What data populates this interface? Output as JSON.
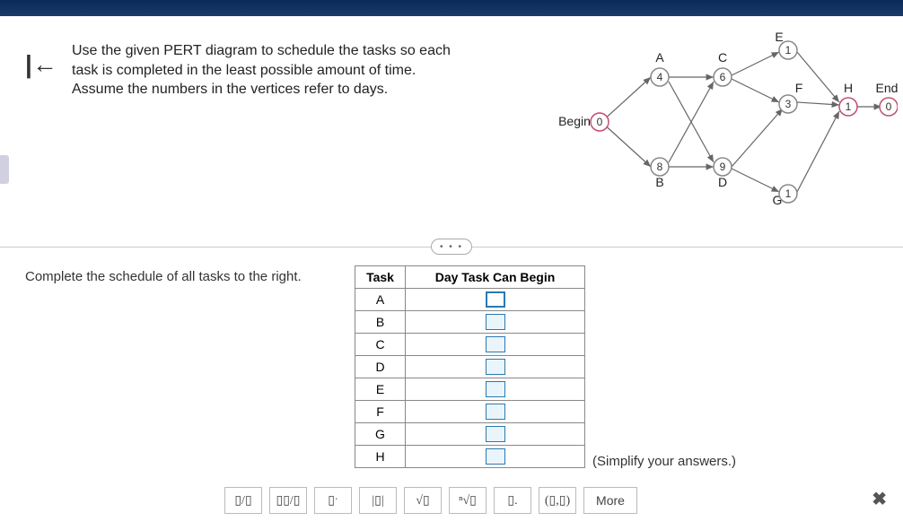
{
  "question": {
    "line1": "Use the given PERT diagram to schedule the tasks so each",
    "line2": "task is completed in the least possible amount of time.",
    "line3": "Assume the numbers in the vertices refer to days."
  },
  "diagram": {
    "begin_label": "Begin",
    "end_label": "End",
    "nodes": {
      "begin": "0",
      "A": "4",
      "B": "8",
      "C": "6",
      "D": "9",
      "E": "1",
      "F": "3",
      "G": "1",
      "H": "1",
      "end": "0"
    },
    "labels": {
      "A": "A",
      "B": "B",
      "C": "C",
      "D": "D",
      "E": "E",
      "F": "F",
      "G": "G",
      "H": "H"
    }
  },
  "lower": {
    "instruction": "Complete the schedule of all tasks to the right.",
    "table_headers": {
      "task": "Task",
      "day": "Day Task Can Begin"
    },
    "tasks": [
      "A",
      "B",
      "C",
      "D",
      "E",
      "F",
      "G",
      "H"
    ],
    "simplify": "(Simplify your answers.)"
  },
  "toolbar": {
    "frac": "▯/▯",
    "mixed": "▯▯/▯",
    "power": "▯ˑ",
    "abs": "|▯|",
    "sqrt": "√▯",
    "nroot": "ⁿ√▯",
    "sub": "▯.",
    "ord": "(▯,▯)",
    "more": "More"
  },
  "pill": "• • •"
}
